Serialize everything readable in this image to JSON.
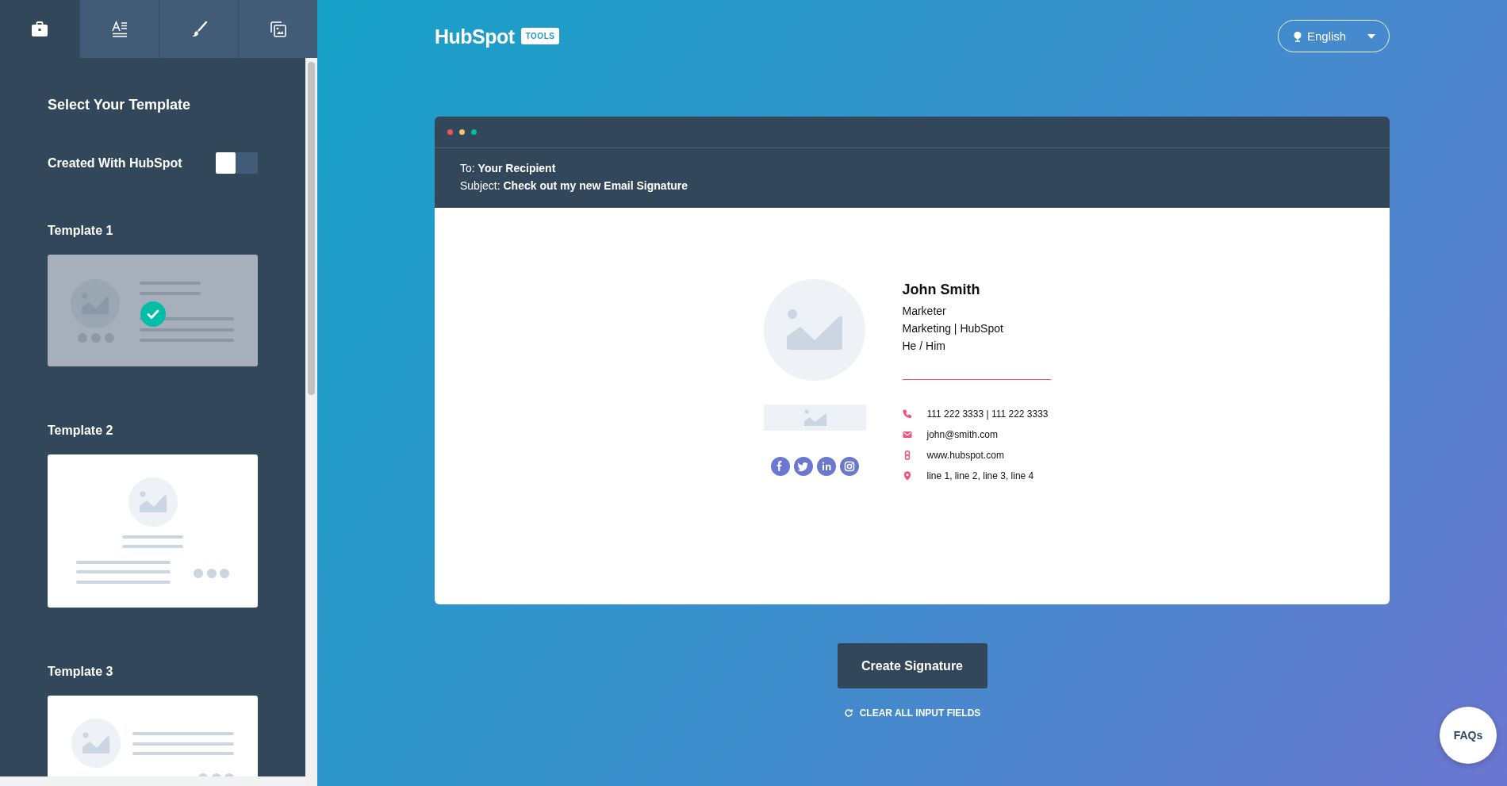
{
  "sidebar": {
    "tabs": [
      {
        "selected": true
      },
      {
        "selected": false
      },
      {
        "selected": false
      },
      {
        "selected": false
      }
    ],
    "heading": "Select Your Template",
    "toggle": {
      "label": "Created With HubSpot",
      "on": false
    },
    "templates": [
      {
        "label": "Template 1",
        "kind": "classic",
        "selected": true
      },
      {
        "label": "Template 2",
        "kind": "centered",
        "selected": false
      },
      {
        "label": "Template 3",
        "kind": "split",
        "selected": false
      }
    ]
  },
  "header": {
    "logo": "HubSpot",
    "logo_tag": "TOOLS",
    "language": "English"
  },
  "email_preview": {
    "window_dots": [
      {
        "color": "#f2545b"
      },
      {
        "color": "#f5c26b"
      },
      {
        "color": "#00bda5"
      }
    ],
    "to": "To: **Your Recipient**",
    "subject": "Subject: **Check out my new Email Signature**",
    "signature": {
      "name": "John Smith",
      "details": [
        "Marketer",
        "Marketing | HubSpot",
        "He / Him"
      ],
      "contacts": [
        {
          "kind": "phone",
          "text": "111 222 3333 | 111 222 3333"
        },
        {
          "kind": "email",
          "text": "john@smith.com"
        },
        {
          "kind": "website",
          "text": "www.hubspot.com"
        },
        {
          "kind": "address",
          "text": "line 1, line 2, line 3, line 4"
        }
      ],
      "social": [
        {
          "kind": "facebook"
        },
        {
          "kind": "twitter"
        },
        {
          "kind": "linkedin"
        },
        {
          "kind": "instagram"
        }
      ]
    }
  },
  "create_button": "Create Signature",
  "clear_link": "CLEAR ALL INPUT FIELDS",
  "faq_button": "FAQs"
}
